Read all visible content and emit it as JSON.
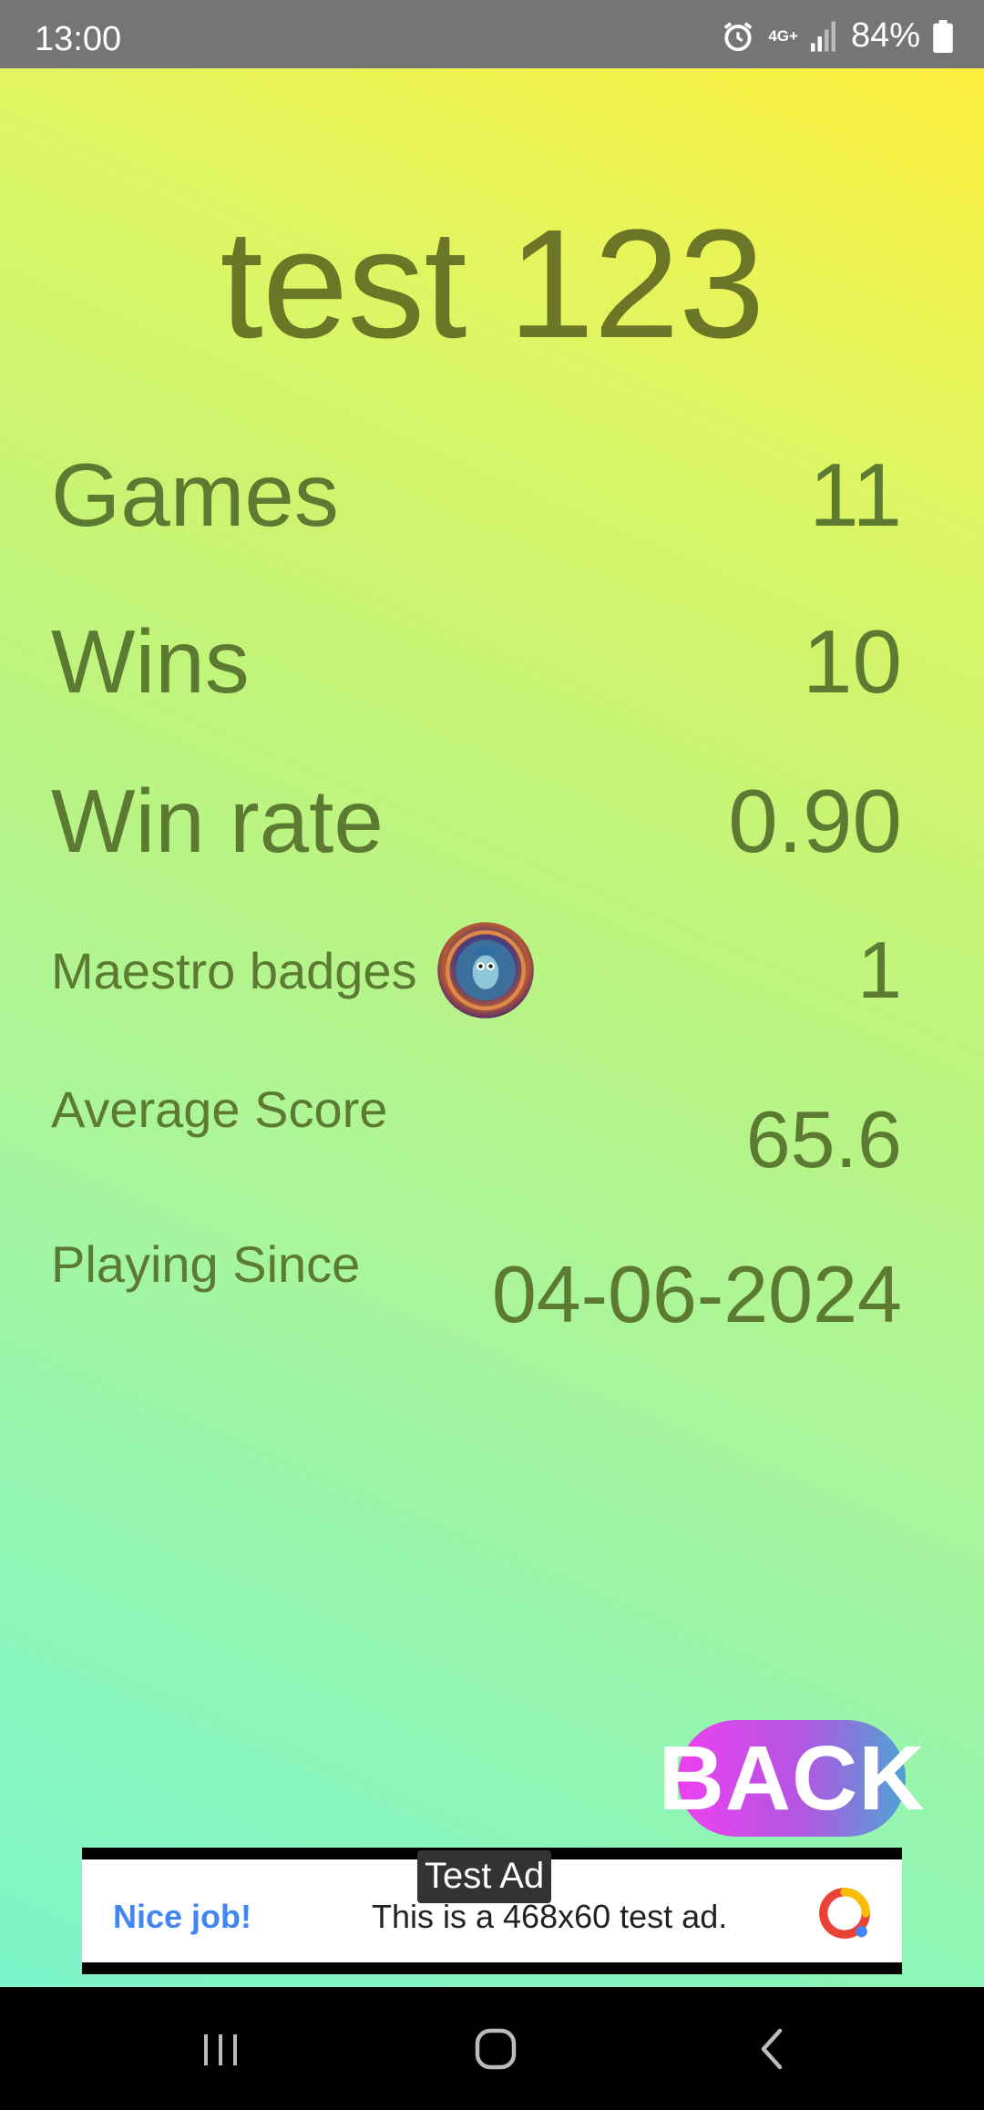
{
  "status_bar": {
    "time": "13:00",
    "network_label": "4G+",
    "battery": "84%",
    "icons": [
      "alarm-icon",
      "network-4g-icon",
      "signal-icon",
      "battery-icon"
    ]
  },
  "profile": {
    "player_name": "test 123"
  },
  "stats": {
    "games": {
      "label": "Games",
      "value": "11"
    },
    "wins": {
      "label": "Wins",
      "value": "10"
    },
    "win_rate": {
      "label": "Win rate",
      "value": "0.90"
    },
    "maestro_badges": {
      "label": "Maestro badges",
      "value": "1"
    },
    "average_score": {
      "label": "Average Score",
      "value": "65.6"
    },
    "playing_since": {
      "label": "Playing Since",
      "value": "04-06-2024"
    }
  },
  "buttons": {
    "back_label": "BACK"
  },
  "ad": {
    "tag": "Test Ad",
    "headline": "Nice job!",
    "text": "This is a 468x60 test ad."
  },
  "colors": {
    "text_primary": "#5c7a31",
    "title": "#6b7626",
    "back_gradient": [
      "#ee3ff0",
      "#b157e2",
      "#4ea3d3"
    ],
    "ad_link": "#4285f4"
  }
}
